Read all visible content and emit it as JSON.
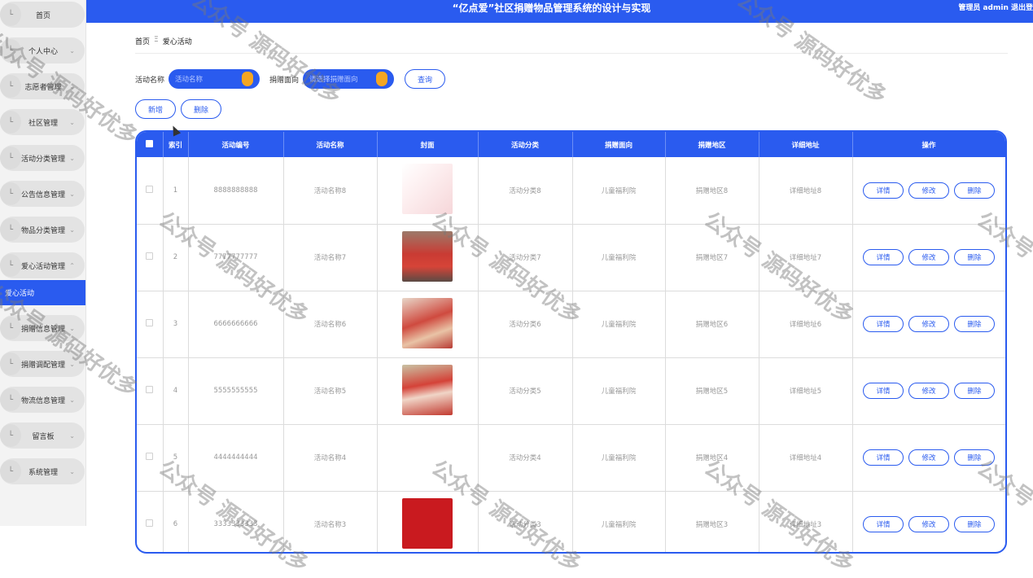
{
  "header": {
    "title": "“亿点爱”社区捐赠物品管理系统的设计与实现",
    "user": "管理员 admin  退出登"
  },
  "sidebar": {
    "items": [
      {
        "label": "首页",
        "arrow": ""
      },
      {
        "label": "个人中心",
        "arrow": "⌄"
      },
      {
        "label": "志愿者管理",
        "arrow": "⌄"
      },
      {
        "label": "社区管理",
        "arrow": "⌄"
      },
      {
        "label": "活动分类管理",
        "arrow": "⌄"
      },
      {
        "label": "公告信息管理",
        "arrow": "⌄"
      },
      {
        "label": "物品分类管理",
        "arrow": "⌄"
      },
      {
        "label": "爱心活动管理",
        "arrow": "⌃"
      },
      {
        "label": "捐赠信息管理",
        "arrow": "⌄"
      },
      {
        "label": "捐赠调配管理",
        "arrow": "⌄"
      },
      {
        "label": "物流信息管理",
        "arrow": "⌄"
      },
      {
        "label": "留言板",
        "arrow": "⌄"
      },
      {
        "label": "系统管理",
        "arrow": "⌄"
      }
    ],
    "active_sub": "爱心活动"
  },
  "breadcrumb": {
    "home": "首页",
    "sep": "Ξ",
    "current": "爱心活动"
  },
  "search": {
    "name_label": "活动名称",
    "name_placeholder": "活动名称",
    "direction_label": "捐赠面向",
    "direction_placeholder": "请选择捐赠面向",
    "query_button": "查询"
  },
  "actions": {
    "add": "新增",
    "delete": "删除"
  },
  "table": {
    "headers": [
      "",
      "索引",
      "活动编号",
      "活动名称",
      "封面",
      "活动分类",
      "捐赠面向",
      "捐赠地区",
      "详细地址",
      "操作"
    ],
    "rows": [
      {
        "index": "1",
        "code": "8888888888",
        "name": "活动名称8",
        "cover": "c1",
        "category": "活动分类8",
        "direction": "儿童福利院",
        "region": "捐赠地区8",
        "address": "详细地址8"
      },
      {
        "index": "2",
        "code": "7777777777",
        "name": "活动名称7",
        "cover": "c2",
        "category": "活动分类7",
        "direction": "儿童福利院",
        "region": "捐赠地区7",
        "address": "详细地址7"
      },
      {
        "index": "3",
        "code": "6666666666",
        "name": "活动名称6",
        "cover": "c3",
        "category": "活动分类6",
        "direction": "儿童福利院",
        "region": "捐赠地区6",
        "address": "详细地址6"
      },
      {
        "index": "4",
        "code": "5555555555",
        "name": "活动名称5",
        "cover": "c4",
        "category": "活动分类5",
        "direction": "儿童福利院",
        "region": "捐赠地区5",
        "address": "详细地址5"
      },
      {
        "index": "5",
        "code": "4444444444",
        "name": "活动名称4",
        "cover": "c5",
        "category": "活动分类4",
        "direction": "儿童福利院",
        "region": "捐赠地区4",
        "address": "详细地址4"
      },
      {
        "index": "6",
        "code": "3333333333",
        "name": "活动名称3",
        "cover": "c6",
        "category": "活动分类3",
        "direction": "儿童福利院",
        "region": "捐赠地区3",
        "address": "详细地址3"
      }
    ],
    "row_actions": {
      "detail": "详情",
      "edit": "修改",
      "delete": "删除"
    }
  },
  "watermark": "公众号 源码好优多",
  "colors": {
    "primary": "#2a5bef",
    "accent": "#f5a623"
  }
}
